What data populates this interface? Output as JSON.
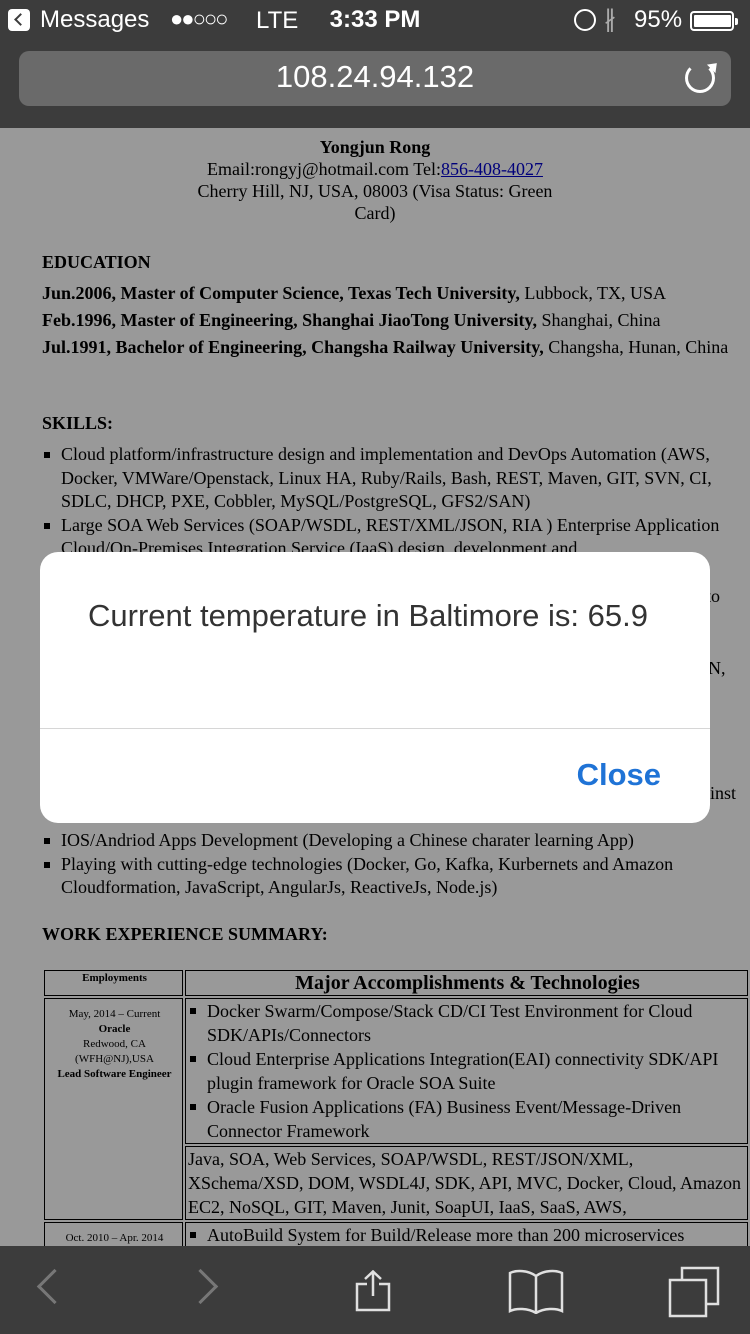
{
  "status_bar": {
    "carrier": "Messages",
    "signal": "●●○○○",
    "network": "LTE",
    "time": "3:33 PM",
    "bluetooth": "∦",
    "battery_percent": "95%"
  },
  "url_bar": {
    "url": "108.24.94.132"
  },
  "resume": {
    "name": "Yongjun Rong",
    "contact_email": "Email:rongyj@hotmail.com Tel:",
    "contact_phone": "856-408-4027",
    "address_line1": "Cherry Hill, NJ, USA, 08003 (Visa Status: Green",
    "address_line2": "Card)",
    "education_heading": "EDUCATION",
    "education": [
      {
        "bold": "Jun.2006, Master of Computer Science, Texas Tech University,",
        "rest": " Lubbock, TX, USA"
      },
      {
        "bold": "Feb.1996, Master of Engineering, Shanghai JiaoTong University,",
        "rest": " Shanghai, China"
      },
      {
        "bold": "Jul.1991, Bachelor of Engineering, Changsha Railway University,",
        "rest": " Changsha, Hunan, China"
      }
    ],
    "skills_heading": "SKILLS:",
    "skills_top": [
      "Cloud platform/infrastructure design and implementation and DevOps Automation (AWS, Docker, VMWare/Openstack, Linux HA, Ruby/Rails, Bash, REST, Maven, GIT, SVN, CI, SDLC, DHCP, PXE, Cobbler, MySQL/PostgreSQL, GFS2/SAN)",
      "Large SOA Web Services (SOAP/WSDL, REST/XML/JSON, RIA ) Enterprise Application Cloud/On-Premises Integration Service (IaaS) design, development and"
    ],
    "fragments": [
      "to",
      "N,",
      "inst"
    ],
    "skills_bottom": [
      "IOS/Andriod Apps Development (Developing a Chinese charater learning App)",
      "Playing with cutting-edge technologies (Docker, Go, Kafka, Kurbernets and Amazon Cloudformation, JavaScript, AngularJs, ReactiveJs, Node.js)"
    ],
    "work_heading": "WORK EXPERIENCE SUMMARY:",
    "table": {
      "col1_header": "Employments",
      "col2_header": "Major Accomplishments & Technologies",
      "row1": {
        "dates": "May, 2014 – Current",
        "company": "Oracle",
        "location": "Redwood, CA",
        "location2": "(WFH@NJ),USA",
        "title": "Lead Software Engineer",
        "accomplishments": [
          "Docker Swarm/Compose/Stack CD/CI Test Environment for Cloud SDK/APIs/Connectors",
          "Cloud Enterprise Applications Integration(EAI) connectivity SDK/API plugin framework for Oracle SOA Suite",
          "Oracle Fusion Applications (FA) Business Event/Message-Driven Connector Framework"
        ],
        "technologies": "Java, SOA, Web Services, SOAP/WSDL, REST/JSON/XML, XSchema/XSD, DOM, WSDL4J, SDK, API, MVC, Docker, Cloud, Amazon EC2, NoSQL, GIT, Maven, Junit, SoapUI, IaaS, SaaS, AWS,"
      },
      "row2": {
        "dates": "Oct. 2010 – Apr. 2014",
        "accomplishments": [
          "AutoBuild System for Build/Release more than 200 microservices"
        ]
      }
    }
  },
  "alert": {
    "message": "Current temperature in Baltimore is: 65.9",
    "button": "Close"
  },
  "toolbar": {
    "icons": [
      "back-icon",
      "forward-icon",
      "share-icon",
      "bookmarks-icon",
      "tabs-icon"
    ]
  }
}
